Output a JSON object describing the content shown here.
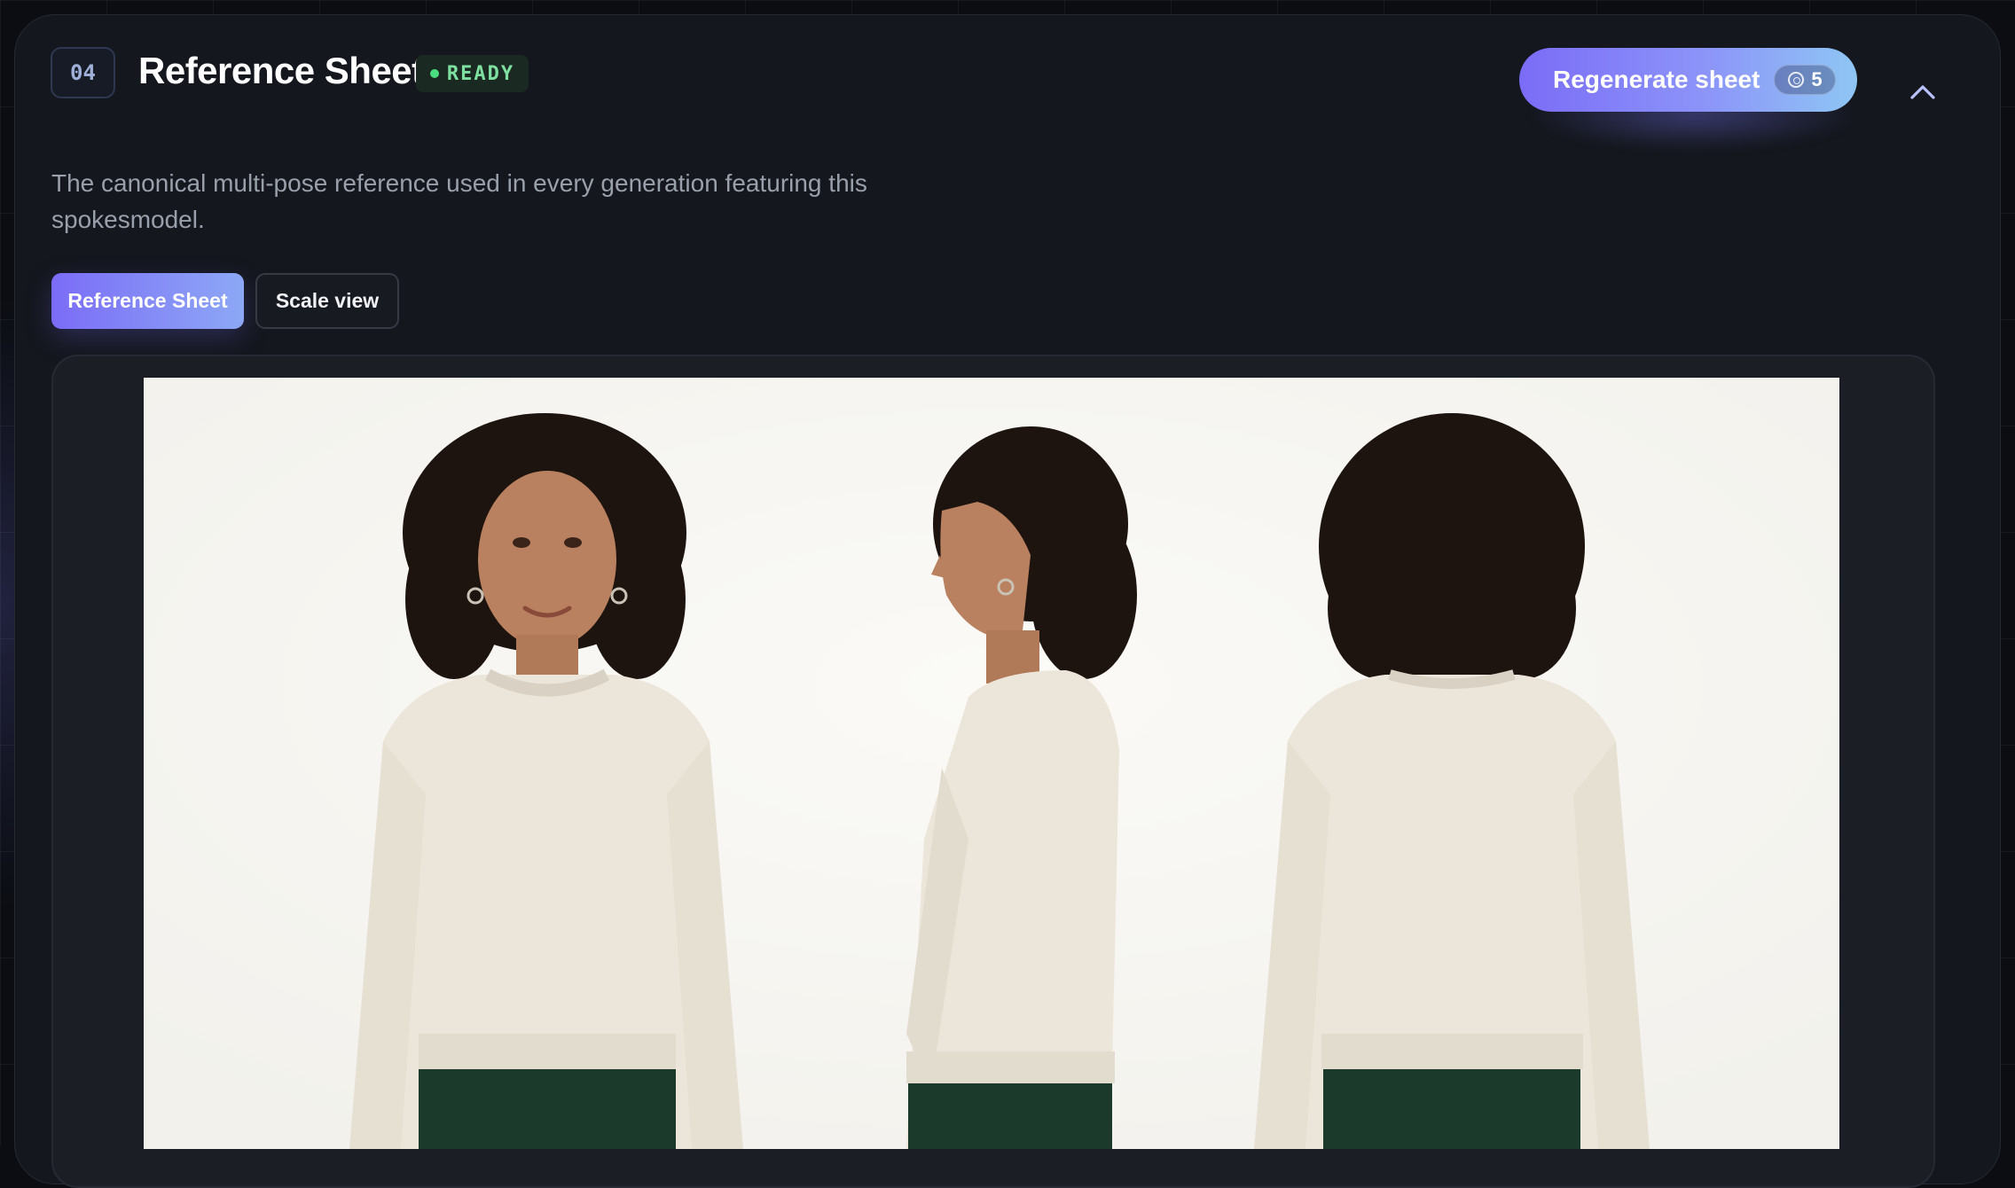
{
  "panel": {
    "step_number": "04",
    "title": "Reference Sheet",
    "status": "READY",
    "description": "The canonical multi-pose reference used in every generation featuring this spokesmodel."
  },
  "actions": {
    "regenerate_label": "Regenerate sheet",
    "credit_cost": "5",
    "collapse_icon": "chevron-up-icon"
  },
  "tabs": [
    {
      "label": "Reference Sheet",
      "active": true
    },
    {
      "label": "Scale view",
      "active": false
    }
  ],
  "image": {
    "subject": "Spokesmodel reference sheet: front, side profile and back views in a cream knit sweater and dark green trousers"
  },
  "colors": {
    "accent_start": "#7b6cf7",
    "accent_end": "#8fc6f4",
    "status_green": "#4ade80",
    "panel_bg": "#14171d"
  }
}
